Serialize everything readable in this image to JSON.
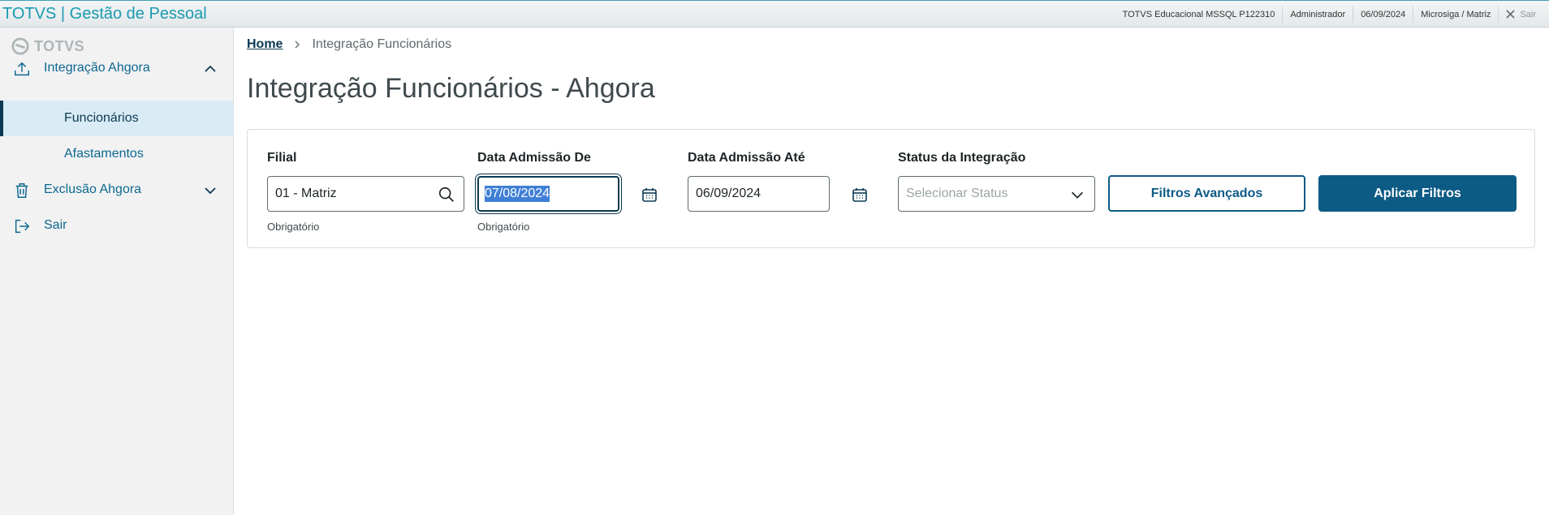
{
  "topbar": {
    "app_name": "TOTVS",
    "separator": "|",
    "module": "Gestão de Pessoal",
    "environment": "TOTVS Educacional MSSQL P122310",
    "user": "Administrador",
    "date": "06/09/2024",
    "company": "Microsiga / Matriz",
    "exit_label": "Sair"
  },
  "sidebar": {
    "brand": "TOTVS",
    "items": [
      {
        "label": "Integração Ahgora",
        "icon": "upload-icon",
        "expanded": true
      },
      {
        "label": "Funcionários",
        "active": true
      },
      {
        "label": "Afastamentos"
      },
      {
        "label": "Exclusão Ahgora",
        "icon": "trash-icon",
        "expanded": false
      },
      {
        "label": "Sair",
        "icon": "logout-icon"
      }
    ]
  },
  "breadcrumb": {
    "home": "Home",
    "current": "Integração Funcionários"
  },
  "page": {
    "title": "Integração Funcionários - Ahgora"
  },
  "filters": {
    "filial": {
      "label": "Filial",
      "value": "01 - Matriz",
      "help": "Obrigatório"
    },
    "date_from": {
      "label": "Data Admissão De",
      "value": "07/08/2024",
      "help": "Obrigatório"
    },
    "date_to": {
      "label": "Data Admissão Até",
      "value": "06/09/2024"
    },
    "status": {
      "label": "Status da Integração",
      "placeholder": "Selecionar Status"
    },
    "advanced_button": "Filtros Avançados",
    "apply_button": "Aplicar Filtros"
  },
  "colors": {
    "brand": "#1a9ab1",
    "primary": "#0c5b85",
    "menu_text": "#0c6890",
    "active_bg": "#d9ecf5",
    "selection": "#3f7fd6"
  }
}
